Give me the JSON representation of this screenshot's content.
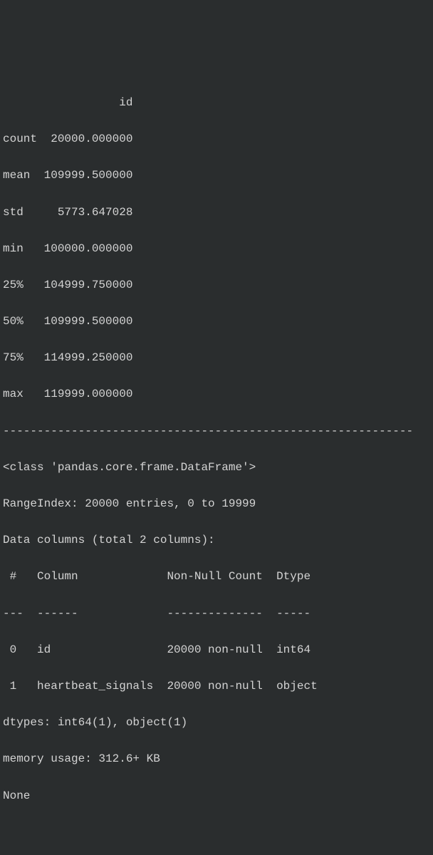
{
  "describe": {
    "header": "                 id",
    "rows": [
      {
        "label": "count",
        "value": "20000.000000"
      },
      {
        "label": "mean",
        "value": "109999.500000"
      },
      {
        "label": "std",
        "value": "5773.647028"
      },
      {
        "label": "min",
        "value": "100000.000000"
      },
      {
        "label": "25%",
        "value": "104999.750000"
      },
      {
        "label": "50%",
        "value": "109999.500000"
      },
      {
        "label": "75%",
        "value": "114999.250000"
      },
      {
        "label": "max",
        "value": "119999.000000"
      }
    ]
  },
  "separator": "------------------------------------------------------------",
  "info": {
    "class_line": "<class 'pandas.core.frame.DataFrame'>",
    "range_index": "RangeIndex: 20000 entries, 0 to 19999",
    "data_columns_header": "Data columns (total 2 columns):",
    "col_header": " #   Column             Non-Null Count  Dtype ",
    "col_divider": "---  ------             --------------  ----- ",
    "columns": [
      {
        "idx": "0",
        "name": "id",
        "nonnull": "20000 non-null",
        "dtype": "int64"
      },
      {
        "idx": "1",
        "name": "heartbeat_signals",
        "nonnull": "20000 non-null",
        "dtype": "object"
      }
    ],
    "dtypes_line": "dtypes: int64(1), object(1)",
    "memory_line": "memory usage: 312.6+ KB",
    "none_line": "None"
  }
}
